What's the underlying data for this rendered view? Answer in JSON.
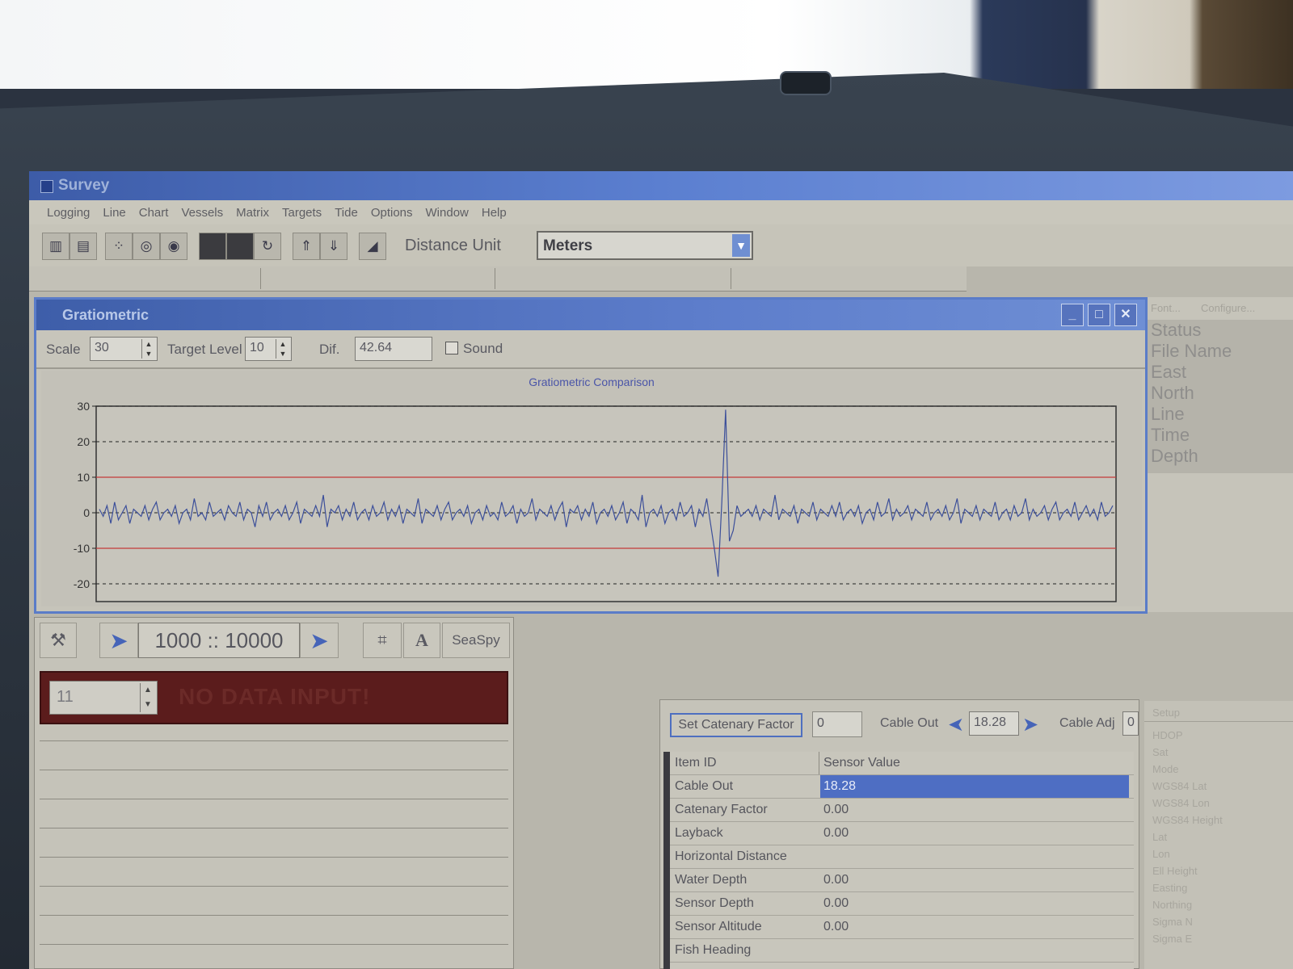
{
  "app": {
    "title": "Survey"
  },
  "menu": [
    "Logging",
    "Line",
    "Chart",
    "Vessels",
    "Matrix",
    "Targets",
    "Tide",
    "Options",
    "Window",
    "Help"
  ],
  "toolbar": {
    "distance_label": "Distance Unit",
    "distance_value": "Meters"
  },
  "gratiometric": {
    "title": "Gratiometric",
    "scale_label": "Scale",
    "scale_value": "30",
    "target_label": "Target Level",
    "target_value": "10",
    "dif_label": "Dif.",
    "dif_value": "42.64",
    "sound_label": "Sound"
  },
  "chart_data": {
    "type": "line",
    "title": "Gratiometric Comparison",
    "ylim": [
      -25,
      30
    ],
    "yticks": [
      30,
      20,
      10,
      0,
      -10,
      -20
    ],
    "target_lines": [
      10,
      -10
    ],
    "series": [
      {
        "values": [
          1,
          -1,
          2,
          -3,
          3,
          -2,
          0,
          2,
          -3,
          1,
          0,
          -1,
          2,
          -2,
          1,
          3,
          -2,
          0,
          1,
          -1,
          2,
          -3,
          0,
          1,
          -2,
          4,
          -1,
          0,
          -2,
          3,
          -1,
          0,
          1,
          -2,
          2,
          0,
          -1,
          3,
          -2,
          1,
          0,
          -4,
          2,
          -1,
          3,
          -2,
          0,
          1,
          -1,
          2,
          -2,
          0,
          3,
          -3,
          1,
          0,
          -1,
          2,
          -1,
          5,
          -4,
          1,
          0,
          2,
          -2,
          1,
          -1,
          3,
          -2,
          0,
          1,
          -2,
          2,
          -1,
          0,
          3,
          -2,
          1,
          -1,
          2,
          -3,
          1,
          0,
          -1,
          4,
          -3,
          1,
          0,
          -1,
          2,
          -2,
          1,
          3,
          -2,
          0,
          1,
          -1,
          2,
          -3,
          0,
          1,
          -2,
          2,
          -1,
          0,
          -2,
          3,
          -1,
          0,
          2,
          -3,
          1,
          -1,
          0,
          4,
          -2,
          1,
          0,
          -1,
          2,
          -2,
          1,
          3,
          -4,
          1,
          0,
          2,
          -2,
          1,
          -1,
          3,
          -3,
          0,
          1,
          -1,
          2,
          -2,
          0,
          3,
          -3,
          1,
          0,
          -2,
          5,
          -4,
          0,
          1,
          -1,
          2,
          -3,
          0,
          1,
          -2,
          3,
          -1,
          0,
          2,
          -4,
          1,
          -1,
          4,
          -3,
          -10,
          -18,
          3,
          29,
          -8,
          -5,
          2,
          -1,
          0,
          1,
          -1,
          2,
          -2,
          1,
          0,
          -1,
          5,
          -2,
          1,
          0,
          -1,
          2,
          -3,
          1,
          0,
          -1,
          3,
          -2,
          1,
          0,
          -1,
          2,
          -1,
          3,
          -2,
          0,
          1,
          -1,
          2,
          -3,
          0,
          1,
          -2,
          3,
          -1,
          0,
          4,
          -2,
          1,
          -1,
          0,
          2,
          -2,
          1,
          0,
          -1,
          3,
          -2,
          0,
          1,
          -1,
          2,
          -2,
          0,
          4,
          -3,
          1,
          0,
          -1,
          2,
          -2,
          1,
          0,
          -1,
          3,
          -2,
          0,
          1,
          -2,
          2,
          -1,
          0,
          4,
          -2,
          1,
          -1,
          0,
          2,
          -2,
          1,
          3,
          -2,
          0,
          1,
          -1,
          3,
          -2,
          0,
          2,
          -1,
          1,
          -2,
          3,
          -1,
          0,
          2
        ]
      }
    ]
  },
  "right_panel": {
    "font": "Font...",
    "configure": "Configure...",
    "items": [
      "Status",
      "File Name",
      "East",
      "North",
      "Line",
      "Time",
      "Depth"
    ]
  },
  "seaspy": {
    "range": "1000 :: 10000",
    "brand": "SeaSpy",
    "channel": "11",
    "message": "NO DATA INPUT!"
  },
  "catenary": {
    "set_button": "Set Catenary Factor",
    "factor_value": "0",
    "cable_out_label": "Cable Out",
    "cable_out_value": "18.28",
    "cable_adj_label": "Cable Adj",
    "cable_adj_value": "0",
    "headers": [
      "Item ID",
      "Sensor Value"
    ],
    "rows": [
      {
        "id": "Cable Out",
        "value": "18.28"
      },
      {
        "id": "Catenary Factor",
        "value": "0.00"
      },
      {
        "id": "Layback",
        "value": "0.00"
      },
      {
        "id": "Horizontal Distance",
        "value": ""
      },
      {
        "id": "Water Depth",
        "value": "0.00"
      },
      {
        "id": "Sensor Depth",
        "value": "0.00"
      },
      {
        "id": "Sensor Altitude",
        "value": "0.00"
      },
      {
        "id": "Fish Heading",
        "value": ""
      }
    ]
  },
  "setup_panel": {
    "title": "Setup",
    "items": [
      "HDOP",
      "Sat",
      "Mode",
      "WGS84 Lat",
      "WGS84 Lon",
      "WGS84 Height",
      "Lat",
      "Lon",
      "Ell Height",
      "Easting",
      "Northing",
      "Sigma N",
      "Sigma E"
    ]
  }
}
